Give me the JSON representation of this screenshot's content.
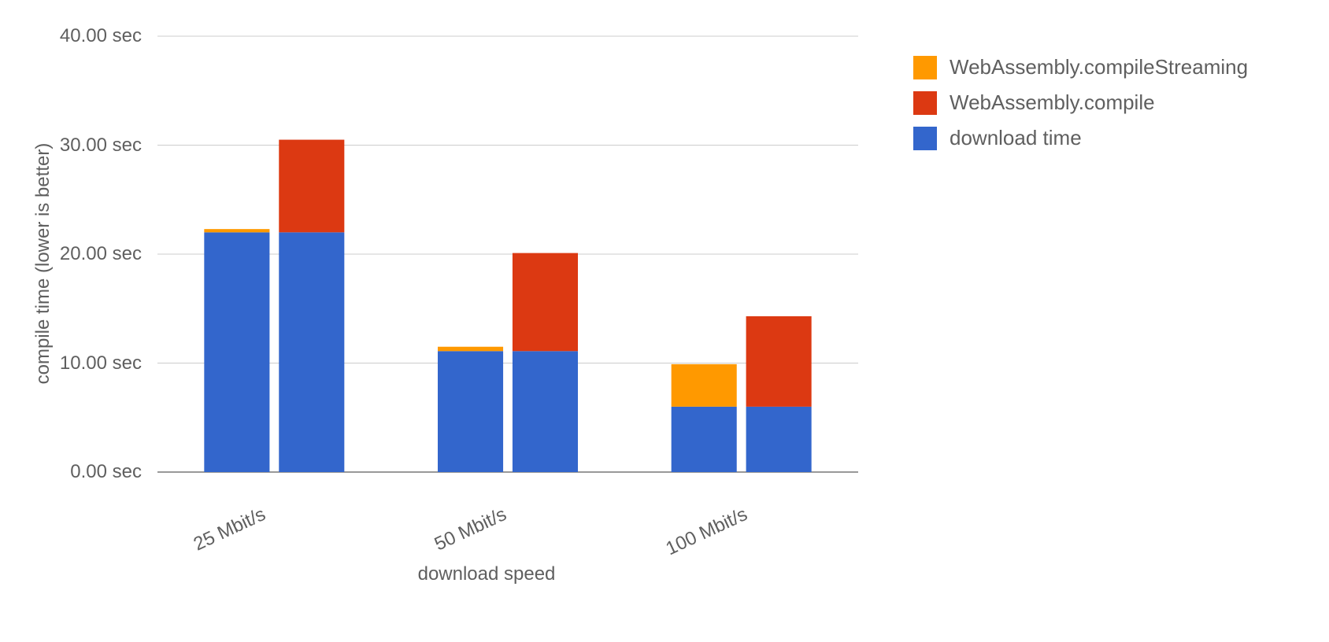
{
  "chart_data": {
    "type": "bar",
    "title": "",
    "xlabel": "download speed",
    "ylabel": "compile time (lower is better)",
    "categories": [
      "25 Mbit/s",
      "50 Mbit/s",
      "100 Mbit/s"
    ],
    "ylim": [
      0,
      40
    ],
    "y_tick_format": "0.00 sec",
    "y_ticks": [
      "0.00 sec",
      "10.00 sec",
      "20.00 sec",
      "30.00 sec",
      "40.00 sec"
    ],
    "colors": {
      "download_time": "#3366cc",
      "compile": "#dc3912",
      "compile_streaming": "#ff9900"
    },
    "legend": [
      {
        "key": "compile_streaming",
        "label": "WebAssembly.compileStreaming"
      },
      {
        "key": "compile",
        "label": "WebAssembly.compile"
      },
      {
        "key": "download_time",
        "label": "download time"
      }
    ],
    "groups": [
      {
        "category": "25 Mbit/s",
        "bars": [
          {
            "which": "streaming",
            "stack": [
              {
                "key": "download_time",
                "value": 22.0
              },
              {
                "key": "compile_streaming",
                "value": 0.3
              }
            ]
          },
          {
            "which": "nonstreaming",
            "stack": [
              {
                "key": "download_time",
                "value": 22.0
              },
              {
                "key": "compile",
                "value": 8.5
              }
            ]
          }
        ]
      },
      {
        "category": "50 Mbit/s",
        "bars": [
          {
            "which": "streaming",
            "stack": [
              {
                "key": "download_time",
                "value": 11.1
              },
              {
                "key": "compile_streaming",
                "value": 0.4
              }
            ]
          },
          {
            "which": "nonstreaming",
            "stack": [
              {
                "key": "download_time",
                "value": 11.1
              },
              {
                "key": "compile",
                "value": 9.0
              }
            ]
          }
        ]
      },
      {
        "category": "100 Mbit/s",
        "bars": [
          {
            "which": "streaming",
            "stack": [
              {
                "key": "download_time",
                "value": 6.0
              },
              {
                "key": "compile_streaming",
                "value": 3.9
              }
            ]
          },
          {
            "which": "nonstreaming",
            "stack": [
              {
                "key": "download_time",
                "value": 6.0
              },
              {
                "key": "compile",
                "value": 8.3
              }
            ]
          }
        ]
      }
    ]
  }
}
